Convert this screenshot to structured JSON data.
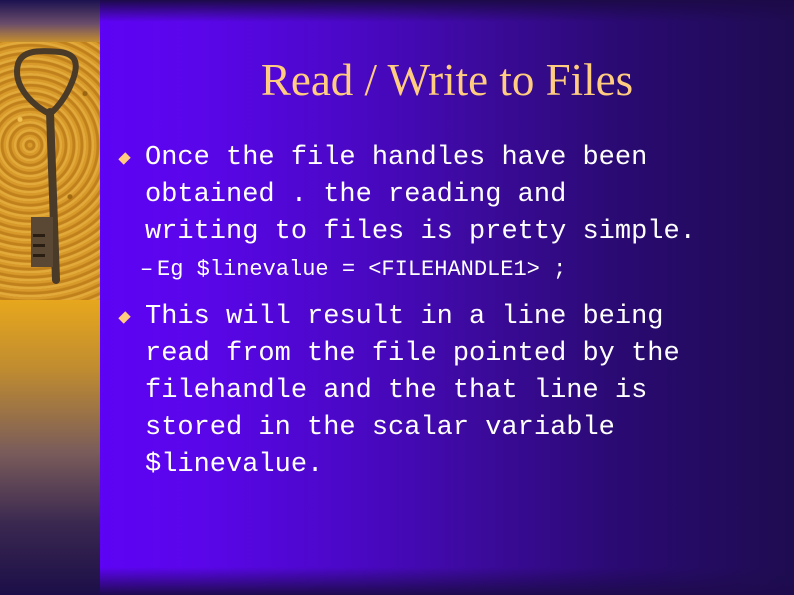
{
  "slide": {
    "title": "Read / Write to Files",
    "image": "key-on-sand-photo",
    "bullets": [
      {
        "icon": "diamond-bullet-icon",
        "lines": [
          "Once the file handles have been",
          "obtained . the reading and",
          "writing to files is pretty simple."
        ],
        "sub_items": [
          {
            "dash": "–",
            "text": "Eg $linevalue = <FILEHANDLE1> ;"
          }
        ]
      },
      {
        "icon": "diamond-bullet-icon",
        "lines": [
          "This will result in a line being",
          "read from the file pointed by the",
          "filehandle and the that line is",
          "stored in the scalar variable",
          "$linevalue."
        ],
        "sub_items": []
      }
    ]
  },
  "colors": {
    "title": "#ffcc80",
    "bullet_marker": "#ffcc80",
    "body_text": "#ffffff",
    "background_left": "#6100ff",
    "background_right": "#1e0c50",
    "strip_gold": "#e8a81c"
  }
}
